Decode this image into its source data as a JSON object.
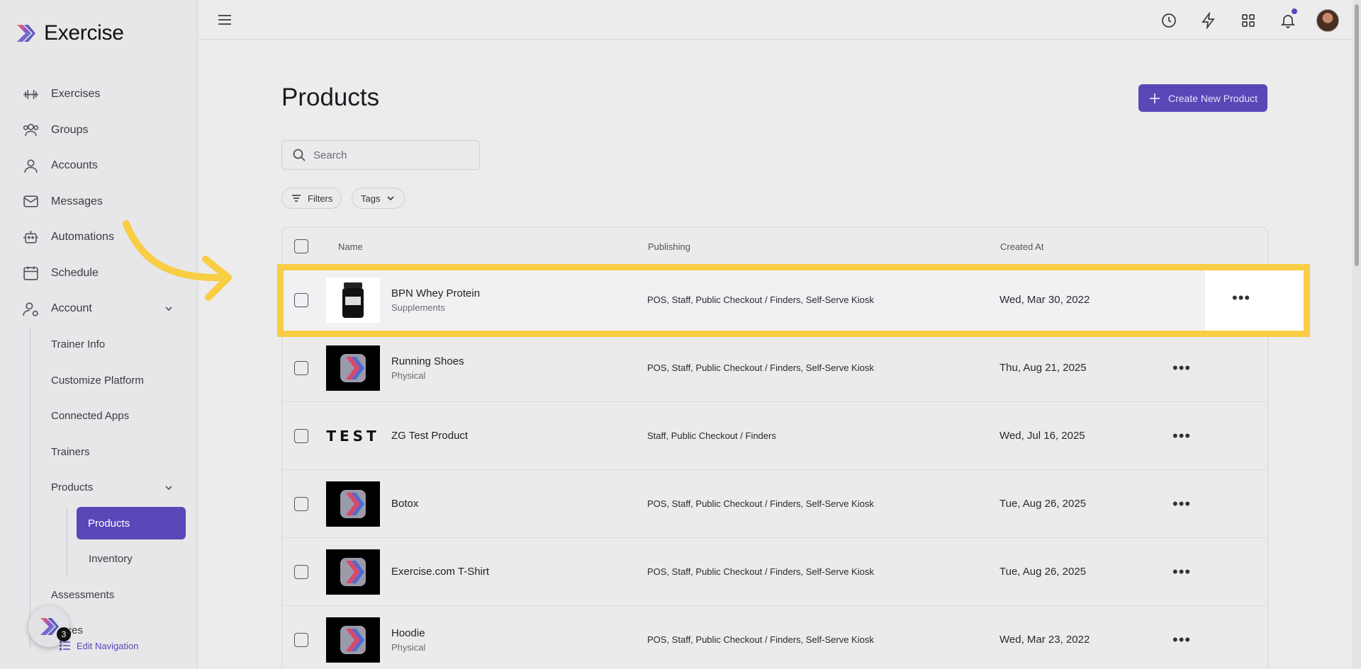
{
  "app": {
    "name": "Exercise"
  },
  "sidebar": {
    "items": [
      {
        "label": "Exercises",
        "icon": "dumbbell-icon"
      },
      {
        "label": "Groups",
        "icon": "users-icon"
      },
      {
        "label": "Accounts",
        "icon": "user-icon"
      },
      {
        "label": "Messages",
        "icon": "mail-icon"
      },
      {
        "label": "Automations",
        "icon": "robot-icon"
      },
      {
        "label": "Schedule",
        "icon": "calendar-icon"
      },
      {
        "label": "Account",
        "icon": "user-gear-icon"
      }
    ],
    "account_sub": [
      "Trainer Info",
      "Customize Platform",
      "Connected Apps",
      "Trainers",
      "Products"
    ],
    "products_sub": [
      "Products",
      "Inventory"
    ],
    "after": [
      "Assessments",
      "ources"
    ],
    "edit_nav": "Edit Navigation",
    "badge_count": "3"
  },
  "main": {
    "title": "Products",
    "create_button": "Create New Product",
    "search_placeholder": "Search",
    "filters_label": "Filters",
    "tags_label": "Tags"
  },
  "table": {
    "headers": {
      "name": "Name",
      "publishing": "Publishing",
      "created": "Created At"
    },
    "rows": [
      {
        "name": "BPN Whey Protein",
        "category": "Supplements",
        "publishing": "POS, Staff, Public Checkout / Finders, Self-Serve Kiosk",
        "created": "Wed, Mar 30, 2022",
        "thumb": "protein"
      },
      {
        "name": "Running Shoes",
        "category": "Physical",
        "publishing": "POS, Staff, Public Checkout / Finders, Self-Serve Kiosk",
        "created": "Thu, Aug 21, 2025",
        "thumb": "logo"
      },
      {
        "name": "ZG Test Product",
        "category": "",
        "publishing": "Staff, Public Checkout / Finders",
        "created": "Wed, Jul 16, 2025",
        "thumb": "test",
        "thumb_text": "TEST"
      },
      {
        "name": "Botox",
        "category": "",
        "publishing": "POS, Staff, Public Checkout / Finders, Self-Serve Kiosk",
        "created": "Tue, Aug 26, 2025",
        "thumb": "logo"
      },
      {
        "name": "Exercise.com T-Shirt",
        "category": "",
        "publishing": "POS, Staff, Public Checkout / Finders, Self-Serve Kiosk",
        "created": "Tue, Aug 26, 2025",
        "thumb": "logo"
      },
      {
        "name": "Hoodie",
        "category": "Physical",
        "publishing": "POS, Staff, Public Checkout / Finders, Self-Serve Kiosk",
        "created": "Wed, Mar 23, 2022",
        "thumb": "logo"
      }
    ]
  },
  "colors": {
    "accent": "#5b46b8",
    "highlight": "#f9cd44"
  }
}
